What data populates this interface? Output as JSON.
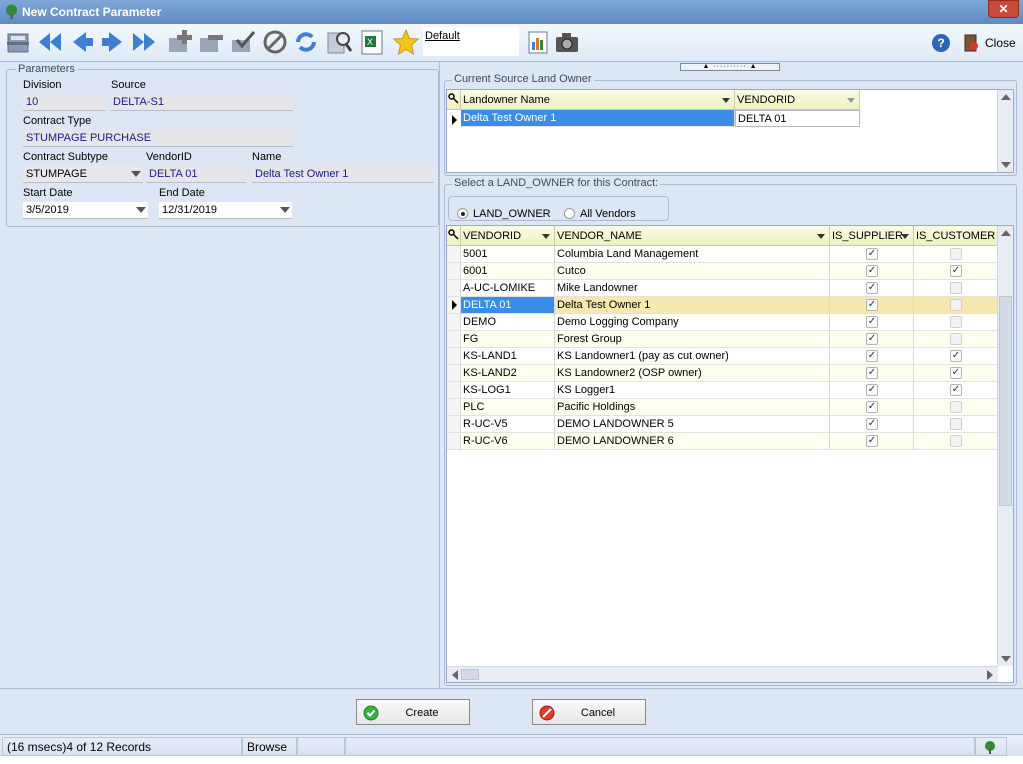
{
  "window": {
    "title": "New Contract Parameter",
    "close_glyph": "✕"
  },
  "toolbar": {
    "favorite_label": "Default",
    "close_label": "Close",
    "help_glyph": "?"
  },
  "parameters": {
    "group_title": "Parameters",
    "division_label": "Division",
    "division_value": "10",
    "source_label": "Source",
    "source_value": "DELTA-S1",
    "contract_type_label": "Contract Type",
    "contract_type_value": "STUMPAGE PURCHASE",
    "contract_subtype_label": "Contract Subtype",
    "contract_subtype_value": "STUMPAGE",
    "vendorid_label": "VendorID",
    "vendorid_value": "DELTA 01",
    "name_label": "Name",
    "name_value": "Delta Test Owner 1",
    "start_date_label": "Start Date",
    "start_date_value": "3/5/2019",
    "end_date_label": "End Date",
    "end_date_value": "12/31/2019"
  },
  "current_owner": {
    "group_title": "Current Source Land Owner",
    "columns": [
      "Landowner Name",
      "VENDORID"
    ],
    "row": [
      "Delta Test Owner 1",
      "DELTA 01"
    ]
  },
  "select_owner": {
    "group_title": "Select a LAND_OWNER for this Contract:",
    "radio_land_owner": "LAND_OWNER",
    "radio_all_vendors": "All Vendors",
    "columns": [
      "VENDORID",
      "VENDOR_NAME",
      "IS_SUPPLIER",
      "IS_CUSTOMER"
    ],
    "selected_index": 3,
    "rows": [
      {
        "id": "5001",
        "name": "Columbia Land Management",
        "supplier": true,
        "customer": false
      },
      {
        "id": "6001",
        "name": "Cutco",
        "supplier": true,
        "customer": true
      },
      {
        "id": "A-UC-LOMIKE",
        "name": "Mike Landowner",
        "supplier": true,
        "customer": false
      },
      {
        "id": "DELTA 01",
        "name": "Delta Test Owner 1",
        "supplier": true,
        "customer": false
      },
      {
        "id": "DEMO",
        "name": "Demo Logging Company",
        "supplier": true,
        "customer": false
      },
      {
        "id": "FG",
        "name": "Forest Group",
        "supplier": true,
        "customer": false
      },
      {
        "id": "KS-LAND1",
        "name": "KS Landowner1 (pay as cut owner)",
        "supplier": true,
        "customer": true
      },
      {
        "id": "KS-LAND2",
        "name": "KS Landowner2 (OSP owner)",
        "supplier": true,
        "customer": true
      },
      {
        "id": "KS-LOG1",
        "name": "KS Logger1",
        "supplier": true,
        "customer": true
      },
      {
        "id": "PLC",
        "name": "Pacific Holdings",
        "supplier": true,
        "customer": false
      },
      {
        "id": "R-UC-V5",
        "name": "DEMO LANDOWNER 5",
        "supplier": true,
        "customer": false
      },
      {
        "id": "R-UC-V6",
        "name": "DEMO LANDOWNER 6",
        "supplier": true,
        "customer": false
      }
    ]
  },
  "actions": {
    "create_label": "Create",
    "cancel_label": "Cancel"
  },
  "status": {
    "records": "(16 msecs)4 of 12 Records",
    "mode": "Browse"
  }
}
